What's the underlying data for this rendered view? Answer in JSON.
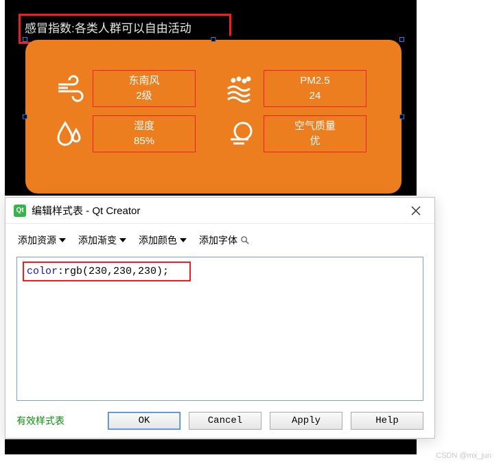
{
  "canvas": {
    "coldIndex": "感冒指数:各类人群可以自由活动",
    "cells": [
      {
        "label": "东南风",
        "value": "2级"
      },
      {
        "label": "PM2.5",
        "value": "24"
      },
      {
        "label": "湿度",
        "value": "85%"
      },
      {
        "label": "空气质量",
        "value": "优"
      }
    ]
  },
  "dialog": {
    "title": "编辑样式表 - Qt Creator",
    "qtBadge": "Qt",
    "toolbar": {
      "addResource": "添加资源",
      "addGradient": "添加渐变",
      "addColor": "添加颜色",
      "addFont": "添加字体"
    },
    "code": {
      "keyword": "color",
      "rest": ":rgb(230,230,230);"
    },
    "validLabel": "有效样式表",
    "buttons": {
      "ok": "OK",
      "cancel": "Cancel",
      "apply": "Apply",
      "help": "Help"
    }
  },
  "watermark": "CSDN @mx_jun"
}
